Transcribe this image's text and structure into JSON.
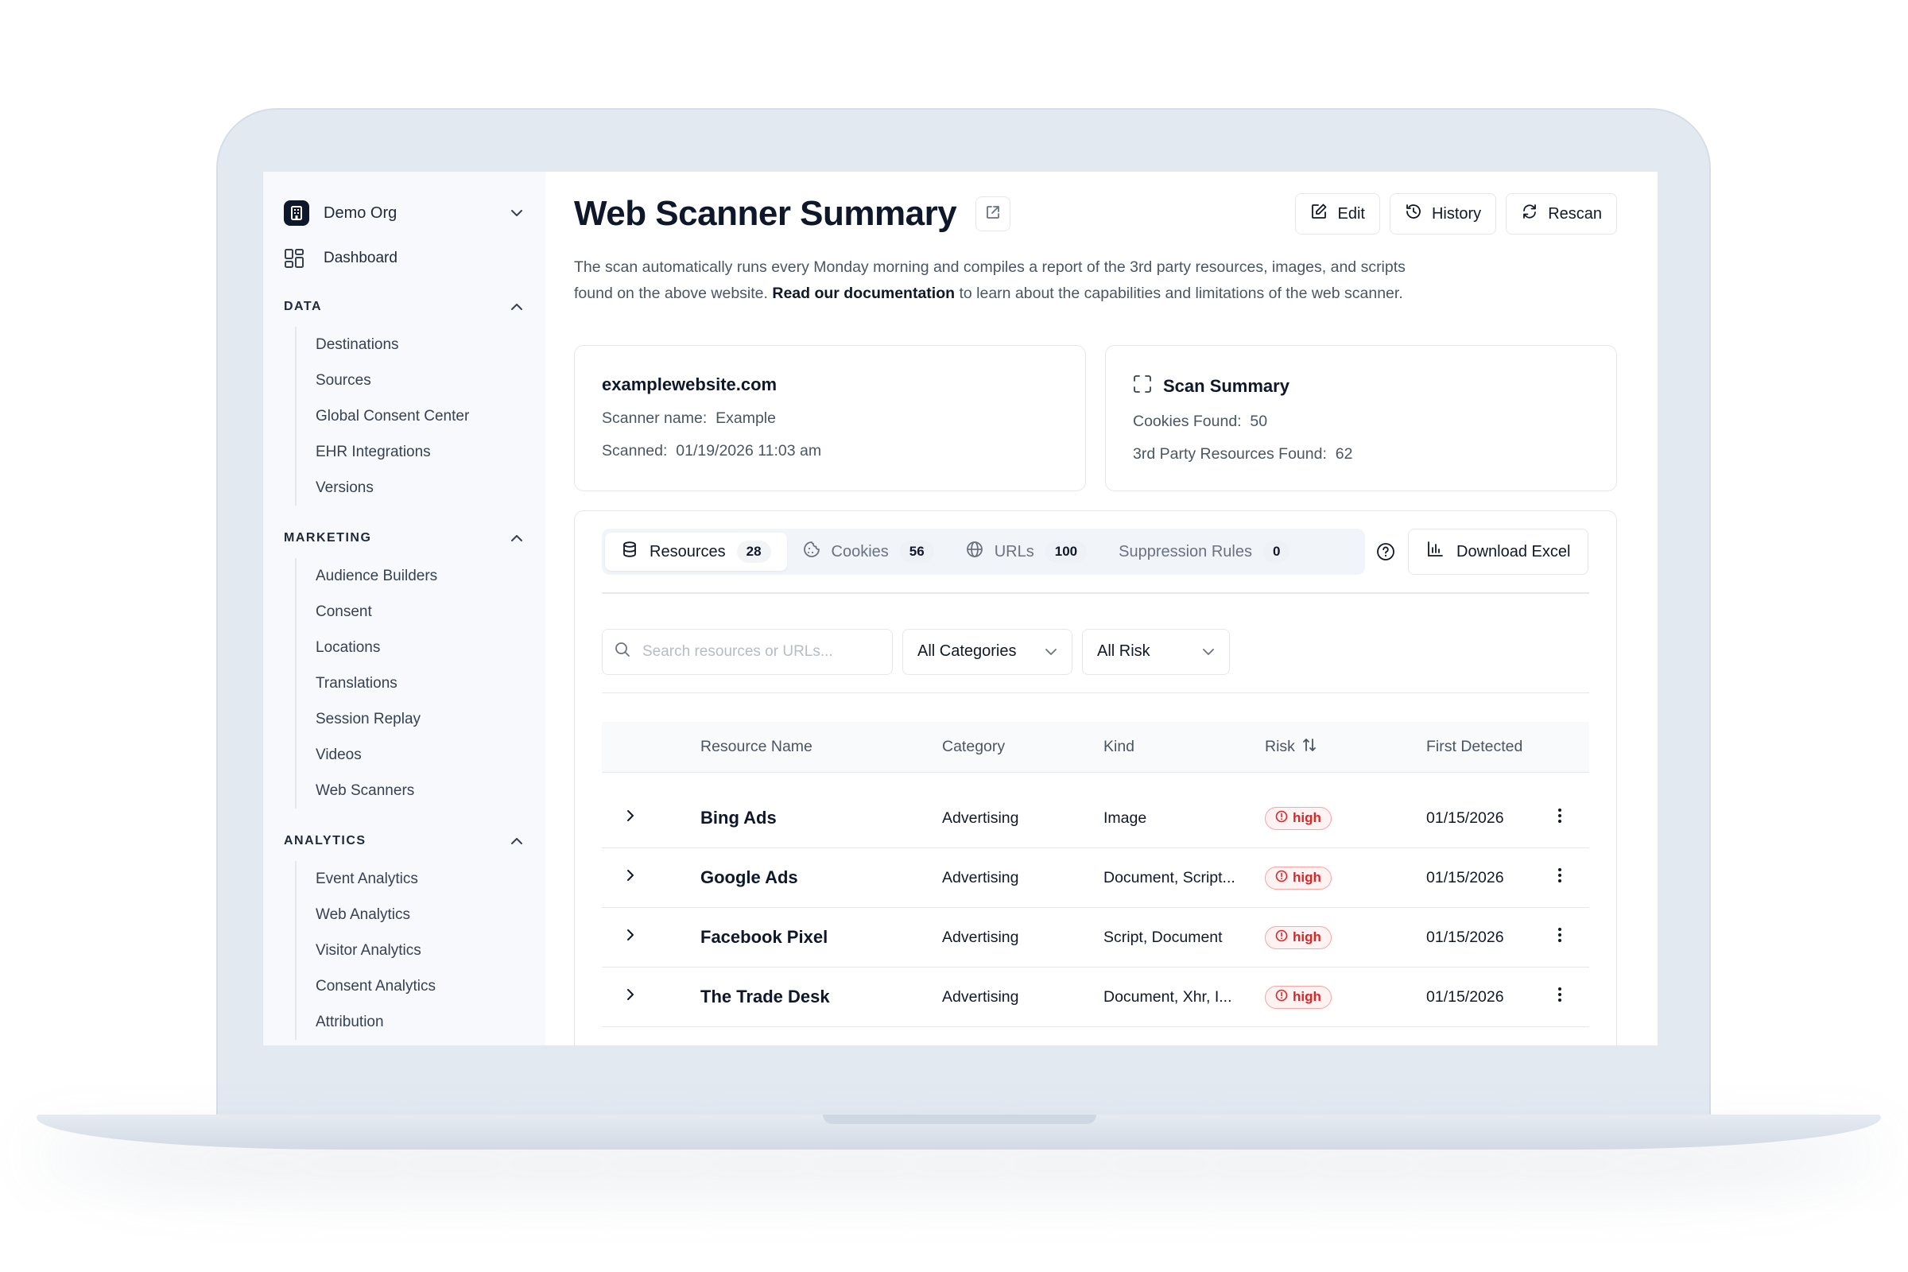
{
  "sidebar": {
    "org_name": "Demo Org",
    "dashboard_label": "Dashboard",
    "sections": [
      {
        "title": "DATA",
        "items": [
          "Destinations",
          "Sources",
          "Global Consent Center",
          "EHR Integrations",
          "Versions"
        ]
      },
      {
        "title": "MARKETING",
        "items": [
          "Audience Builders",
          "Consent",
          "Locations",
          "Translations",
          "Session Replay",
          "Videos",
          "Web Scanners"
        ]
      },
      {
        "title": "ANALYTICS",
        "items": [
          "Event Analytics",
          "Web Analytics",
          "Visitor Analytics",
          "Consent Analytics",
          "Attribution"
        ]
      }
    ]
  },
  "header": {
    "title": "Web Scanner Summary",
    "edit_label": "Edit",
    "history_label": "History",
    "rescan_label": "Rescan"
  },
  "description": {
    "part1": "The scan automatically runs every Monday morning and compiles a report of the 3rd party resources, images, and scripts found on the above website.",
    "link": "Read our documentation",
    "part2": "to learn about the capabilities and limitations of the web scanner."
  },
  "site_card": {
    "domain": "examplewebsite.com",
    "scanner_name_label": "Scanner name:",
    "scanner_name_value": "Example",
    "scanned_label": "Scanned:",
    "scanned_value": "01/19/2026 11:03 am"
  },
  "summary_card": {
    "title": "Scan Summary",
    "cookies_label": "Cookies Found:",
    "cookies_value": "50",
    "resources_label": "3rd Party Resources Found:",
    "resources_value": "62"
  },
  "tabs": [
    {
      "label": "Resources",
      "count": "28",
      "icon": "database-icon"
    },
    {
      "label": "Cookies",
      "count": "56",
      "icon": "cookie-icon"
    },
    {
      "label": "URLs",
      "count": "100",
      "icon": "globe-icon"
    },
    {
      "label": "Suppression Rules",
      "count": "0",
      "icon": ""
    }
  ],
  "download_label": "Download Excel",
  "filters": {
    "search_placeholder": "Search resources or URLs...",
    "category_value": "All Categories",
    "risk_value": "All Risk"
  },
  "table": {
    "headers": [
      "Resource Name",
      "Category",
      "Kind",
      "Risk",
      "First Detected"
    ],
    "rows": [
      {
        "name": "Bing Ads",
        "category": "Advertising",
        "kind": "Image",
        "risk": "high",
        "date": "01/15/2026"
      },
      {
        "name": "Google Ads",
        "category": "Advertising",
        "kind": "Document, Script...",
        "risk": "high",
        "date": "01/15/2026"
      },
      {
        "name": "Facebook Pixel",
        "category": "Advertising",
        "kind": "Script, Document",
        "risk": "high",
        "date": "01/15/2026"
      },
      {
        "name": "The Trade Desk",
        "category": "Advertising",
        "kind": "Document, Xhr, I...",
        "risk": "high",
        "date": "01/15/2026"
      }
    ]
  },
  "colors": {
    "risk_high": "#dc2626",
    "accent_dark": "#0f172a",
    "frame": "#e3e9f1"
  }
}
